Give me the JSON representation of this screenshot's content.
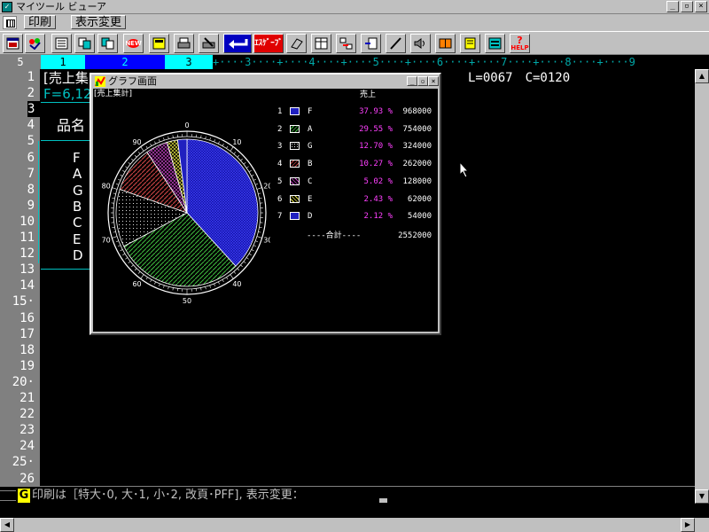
{
  "window": {
    "title": "マイツール ビューア",
    "buttons": {
      "minimize": "_",
      "restore": "▫",
      "close": "×"
    }
  },
  "menu": {
    "items": [
      {
        "label": "印刷"
      },
      {
        "label": "表示変更"
      }
    ]
  },
  "toolbar": {
    "buttons": [
      {
        "icon": "window-icon"
      },
      {
        "icon": "color-palette-icon"
      },
      {
        "icon": "calculator-icon"
      },
      {
        "icon": "copy-icon"
      },
      {
        "icon": "paste-icon"
      },
      {
        "icon": "new-icon",
        "text": "NEW"
      },
      {
        "icon": "save-icon"
      },
      {
        "icon": "print-icon"
      },
      {
        "icon": "print-setup-icon"
      },
      {
        "icon": "enter-icon"
      },
      {
        "icon": "easy-icon",
        "text": "ｴｽｹﾞｰﾌﾞ"
      },
      {
        "icon": "eraser-icon"
      },
      {
        "icon": "table-icon"
      },
      {
        "icon": "transfer-icon"
      },
      {
        "icon": "insert-icon"
      },
      {
        "icon": "pen-icon"
      },
      {
        "icon": "speaker-icon"
      },
      {
        "icon": "book-icon"
      },
      {
        "icon": "memo-icon"
      },
      {
        "icon": "exchange-icon"
      },
      {
        "icon": "help-icon",
        "text": "HELP"
      }
    ]
  },
  "ruler": {
    "corner": "5",
    "col1": "1",
    "col2": "2",
    "col3": "3",
    "rest": "+····3····+····4····+····5····+····6····+····7····+····8····+····9"
  },
  "gutter": {
    "lines": [
      "1",
      "2",
      "3",
      "4",
      "5",
      "6",
      "7",
      "8",
      "9",
      "10",
      "11",
      "12",
      "13",
      "14",
      "15·",
      "16",
      "17",
      "18",
      "19",
      "20·",
      "21",
      "22",
      "23",
      "24",
      "25·",
      "26"
    ]
  },
  "editor": {
    "line1": "[売上集",
    "line2": "F=6,12",
    "cursor_info": "L=0067　C=0120",
    "header_label": "品名",
    "items": [
      "F",
      "A",
      "G",
      "B",
      "C",
      "E",
      "D"
    ]
  },
  "status": {
    "key": "G",
    "prompt": "印刷は［特大･0, 大･1, 小･2, 改頁･PFF], 表示変更："
  },
  "graph_window": {
    "title": "グラフ画面",
    "subtitle": "[売上集計]",
    "column_header": "売上",
    "total_label": "----合計----",
    "total_value": "2552000",
    "dial_ticks": [
      "0",
      "10",
      "20",
      "30",
      "40",
      "50",
      "60",
      "70",
      "80",
      "90"
    ]
  },
  "chart_data": {
    "type": "pie",
    "title": "[売上集計]",
    "ylabel": "売上",
    "categories": [
      "F",
      "A",
      "G",
      "B",
      "C",
      "E",
      "D"
    ],
    "index": [
      "1",
      "2",
      "3",
      "4",
      "5",
      "6",
      "7"
    ],
    "percent_labels": [
      "37.93 %",
      "29.55 %",
      "12.70 %",
      "10.27 %",
      "5.02 %",
      "2.43 %",
      "2.12 %"
    ],
    "values": [
      968000,
      754000,
      324000,
      262000,
      128000,
      62000,
      54000
    ],
    "value_labels": [
      "968000",
      "754000",
      "324000",
      "262000",
      "128000",
      "62000",
      "54000"
    ],
    "total": 2552000,
    "colors": [
      "#2020c0",
      "#40c040",
      "#e0e0e0",
      "#c04040",
      "#c040c0",
      "#e0e040",
      "#2020c0"
    ],
    "patterns": [
      "crosshatch",
      "diagonal",
      "dots",
      "diagonal",
      "crosshatch",
      "crosshatch",
      "solid"
    ]
  },
  "colors": {
    "chrome": "#c0c0c0",
    "ruler_highlight": "#00ffff",
    "ruler_current": "#0000ff",
    "percent_text": "#ff40ff",
    "editor_cyan": "#00c0c0"
  }
}
